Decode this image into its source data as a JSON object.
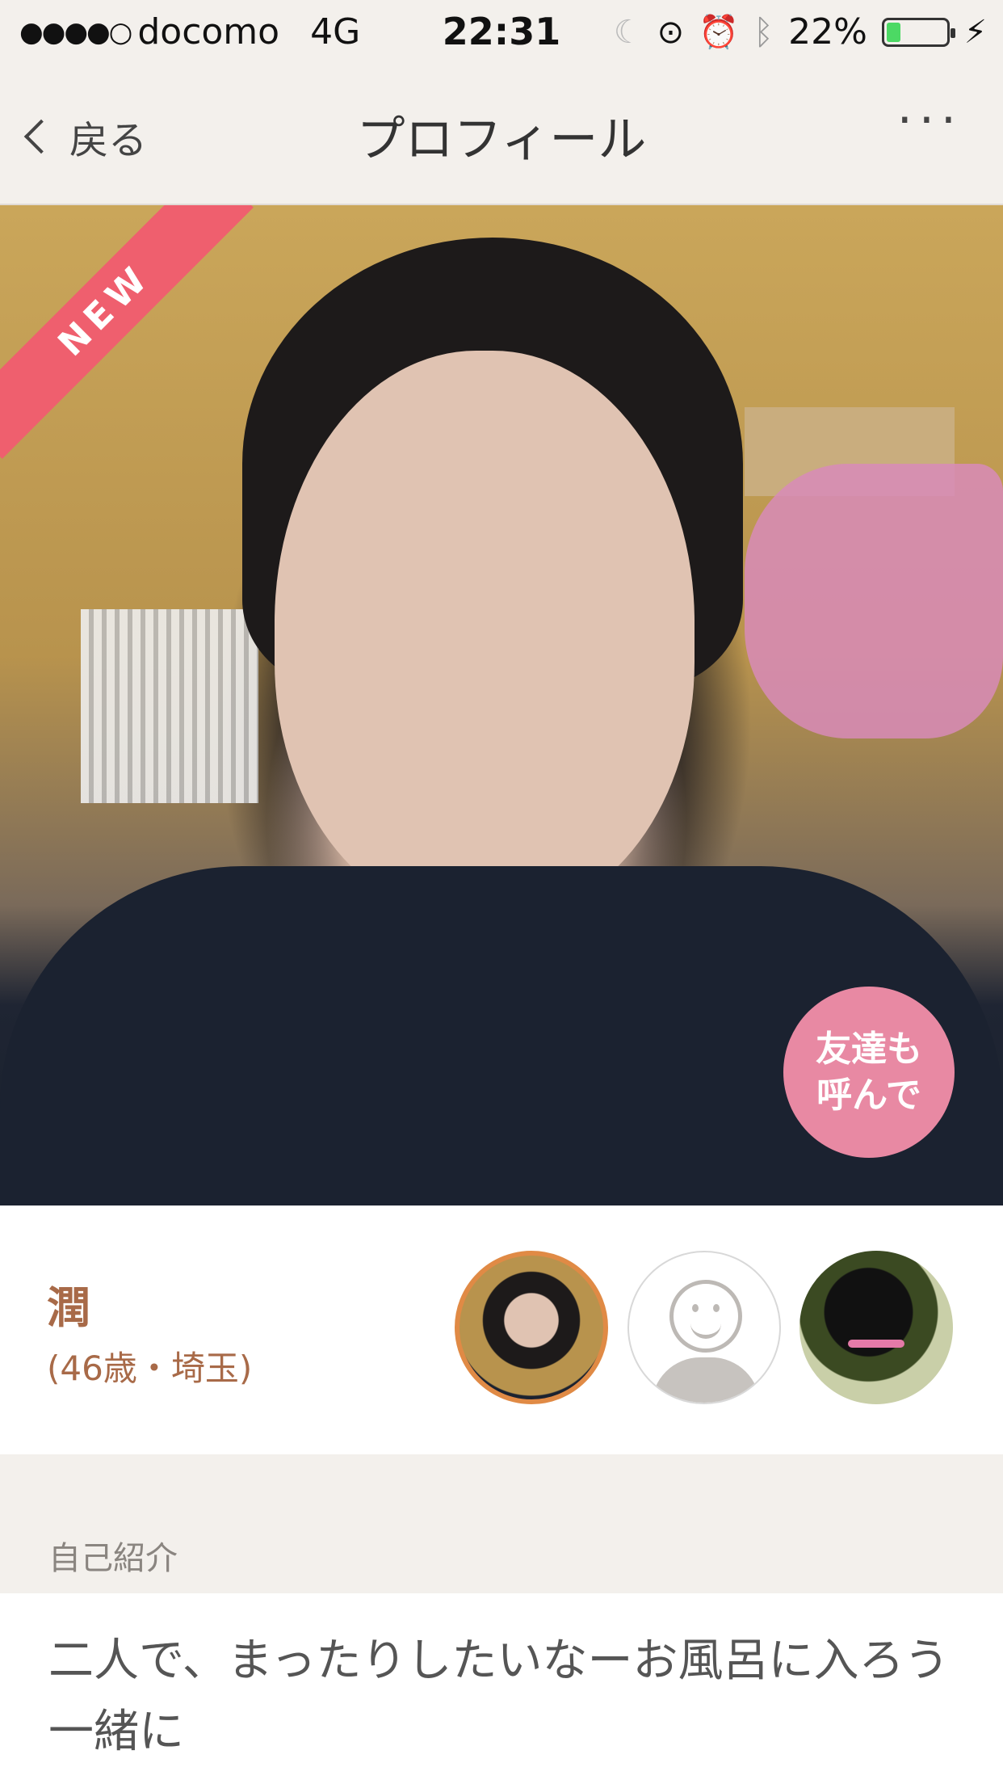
{
  "status_bar": {
    "signal": "●●●●○",
    "carrier": "docomo",
    "network": "4G",
    "time": "22:31",
    "icons": [
      "moon-icon",
      "rotation-lock-icon",
      "alarm-icon",
      "bluetooth-icon"
    ],
    "battery_percent_text": "22%",
    "battery_level": 0.22
  },
  "navbar": {
    "back_label": "戻る",
    "title": "プロフィール",
    "more_label": "···"
  },
  "photo": {
    "badge": "NEW",
    "invite_line1": "友達も",
    "invite_line2": "呼んで"
  },
  "profile": {
    "name": "潤",
    "meta": "(46歳・埼玉)",
    "avatars": [
      "user-photo-1",
      "default-avatar",
      "cat-photo"
    ]
  },
  "section": {
    "title": "自己紹介"
  },
  "intro": {
    "text": "二人で、まったりしたいなーお風呂に入ろう一緒に"
  },
  "colors": {
    "accent": "#a86a48",
    "badge": "#ef5f6e",
    "invite": "#e889a3",
    "selected_ring": "#e08a45",
    "background": "#f3f0ec"
  }
}
